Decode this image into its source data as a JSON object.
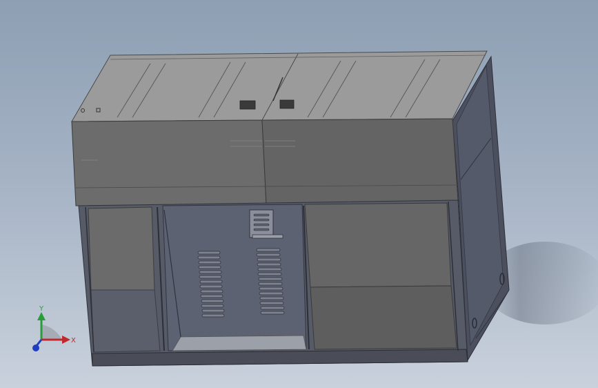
{
  "viewport": {
    "background_top": "#8e9fb3",
    "background_bottom": "#c9d1dc"
  },
  "model": {
    "body_color": "#5c5f6a",
    "top_color": "#9a9a9a",
    "front_color": "#6a6a6a",
    "side_color": "#4b4f5e",
    "interior_color": "#5a5f70"
  },
  "triad": {
    "y_label": "Y",
    "x_label": "X",
    "x_color": "#c0282d",
    "y_color": "#2a9d3a",
    "z_color": "#1f3fc0"
  }
}
